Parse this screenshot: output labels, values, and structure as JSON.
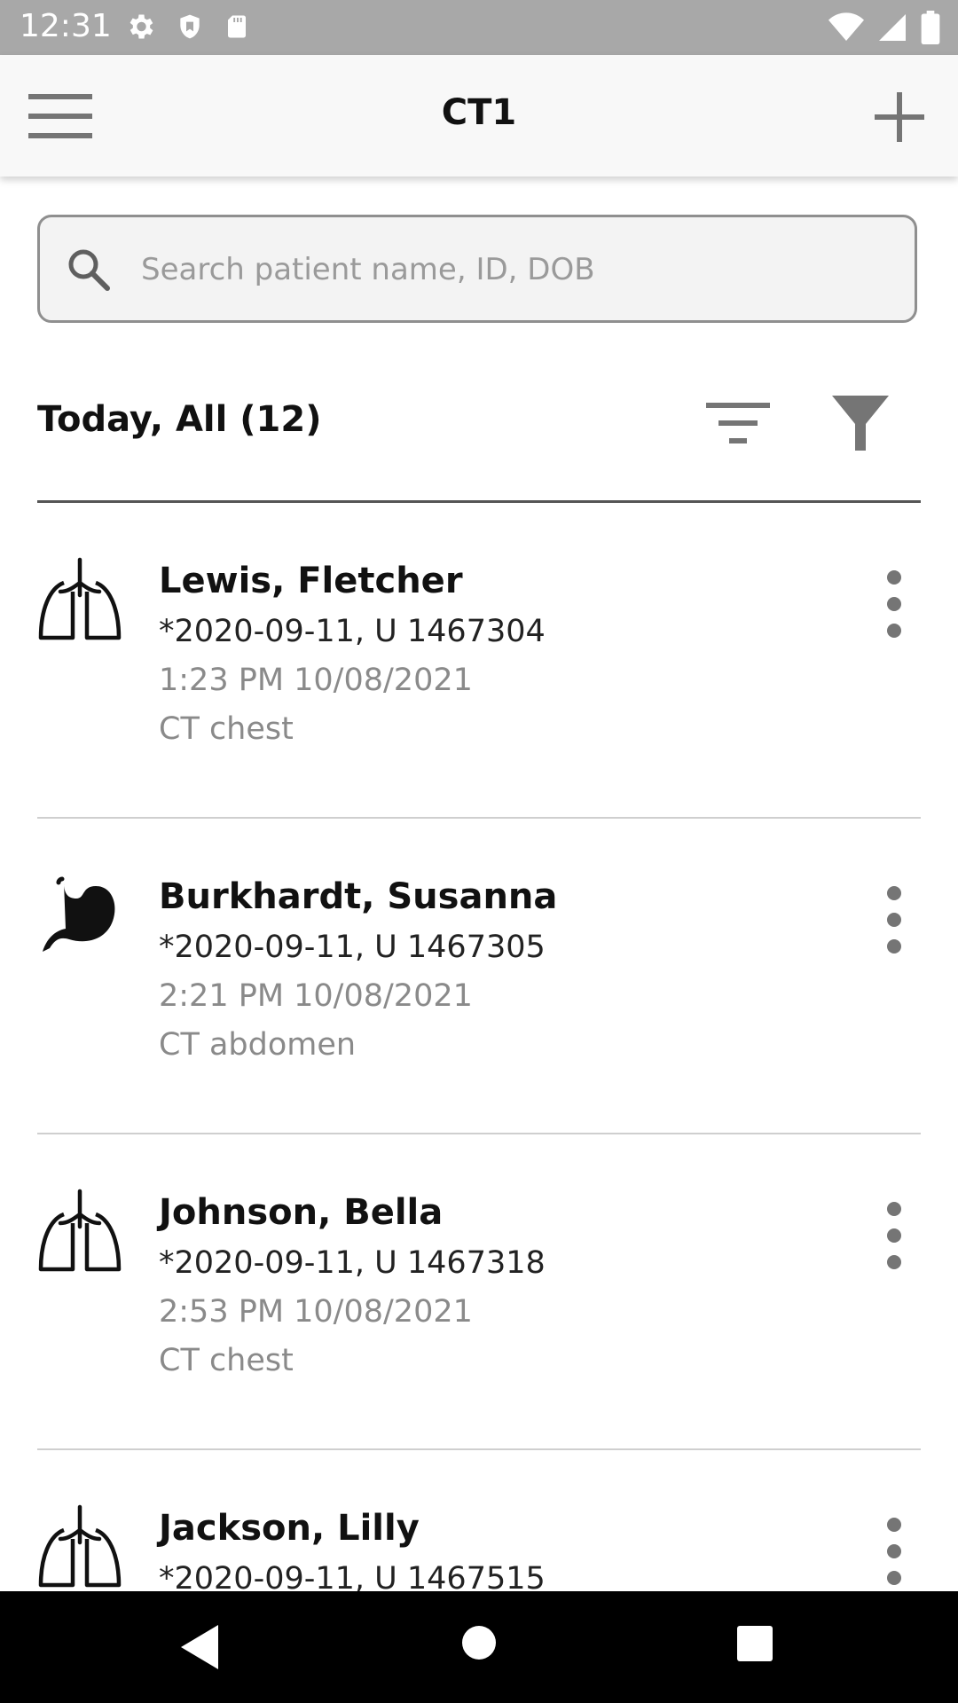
{
  "status_bar": {
    "time": "12:31",
    "left_icons": [
      "settings-icon",
      "shield-icon",
      "sd-card-icon"
    ],
    "right_icons": [
      "wifi-icon",
      "signal-icon",
      "battery-icon"
    ]
  },
  "app_bar": {
    "title": "CT1",
    "menu_icon": "hamburger-menu-icon",
    "add_icon": "plus-icon"
  },
  "search": {
    "placeholder": "Search patient name, ID, DOB",
    "value": ""
  },
  "list": {
    "header": "Today, All (12)",
    "sort_icon": "sort-icon",
    "filter_icon": "filter-funnel-icon",
    "patients": [
      {
        "name": "Lewis, Fletcher",
        "id_line": "*2020-09-11, U 1467304",
        "time": "1:23 PM 10/08/2021",
        "exam": "CT chest",
        "organ_icon": "lungs-icon"
      },
      {
        "name": "Burkhardt, Susanna",
        "id_line": "*2020-09-11, U 1467305",
        "time": "2:21 PM 10/08/2021",
        "exam": "CT abdomen",
        "organ_icon": "stomach-icon"
      },
      {
        "name": "Johnson, Bella",
        "id_line": "*2020-09-11, U 1467318",
        "time": "2:53 PM 10/08/2021",
        "exam": "CT chest",
        "organ_icon": "lungs-icon"
      },
      {
        "name": "Jackson, Lilly",
        "id_line": "*2020-09-11, U 1467515",
        "time": "",
        "exam": "",
        "organ_icon": "lungs-icon"
      }
    ]
  },
  "colors": {
    "status_bar_bg": "#a8a8a8",
    "app_bar_bg": "#f8f8f8",
    "secondary_text": "#8a8a8a",
    "icon_gray": "#757575"
  }
}
